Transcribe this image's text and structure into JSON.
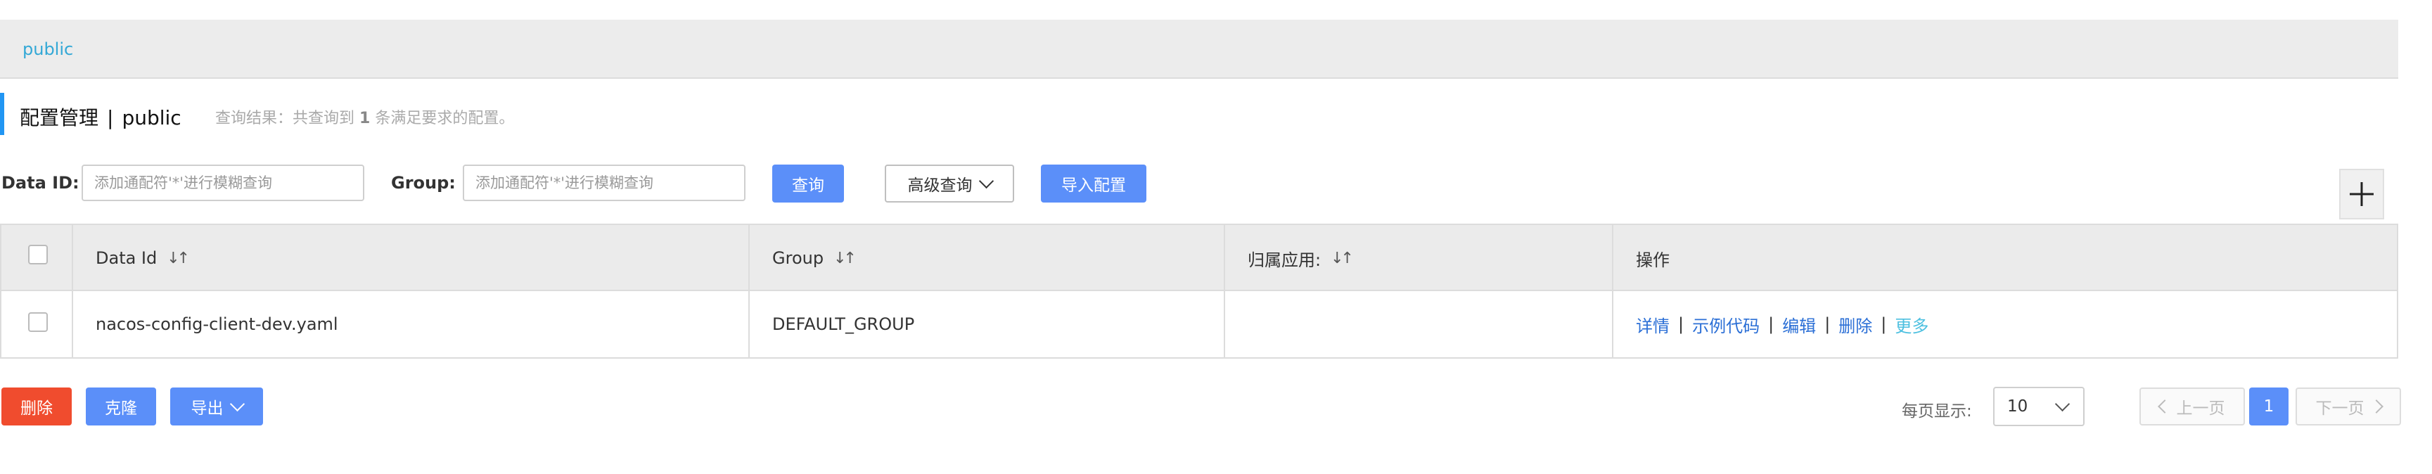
{
  "namespace_tab": "public",
  "header": {
    "title": "配置管理",
    "separator": "|",
    "namespace": "public",
    "query_result_prefix": "查询结果：共查询到",
    "query_result_count": "1",
    "query_result_suffix": "条满足要求的配置。"
  },
  "filters": {
    "data_id_label": "Data ID:",
    "data_id_placeholder": "添加通配符'*'进行模糊查询",
    "data_id_value": "",
    "group_label": "Group:",
    "group_placeholder": "添加通配符'*'进行模糊查询",
    "group_value": "",
    "search_button": "查询",
    "advanced_button": "高级查询",
    "import_button": "导入配置"
  },
  "table": {
    "columns": [
      "Data Id",
      "Group",
      "归属应用:",
      "操作"
    ],
    "rows": [
      {
        "data_id": "nacos-config-client-dev.yaml",
        "group": "DEFAULT_GROUP",
        "app": "",
        "actions": [
          "详情",
          "示例代码",
          "编辑",
          "删除",
          "更多"
        ]
      }
    ]
  },
  "footer": {
    "delete_button": "删除",
    "clone_button": "克隆",
    "export_button": "导出",
    "page_size_label": "每页显示:",
    "page_size_value": "10",
    "prev_button": "上一页",
    "current_page": "1",
    "next_button": "下一页"
  },
  "colors": {
    "primary": "#5b8ff9",
    "danger": "#f04c2e",
    "link": "#2b6fd6",
    "accent": "#33a8d6"
  }
}
